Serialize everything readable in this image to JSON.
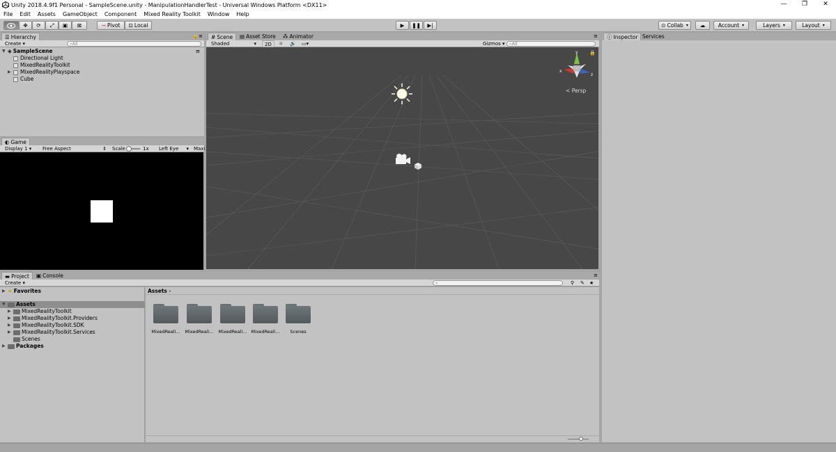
{
  "window": {
    "title": "Unity 2018.4.9f1 Personal - SampleScene.unity - ManipulationHandlerTest - Universal Windows Platform <DX11>",
    "buttons": [
      "—",
      "❐",
      "✕"
    ]
  },
  "menubar": [
    "File",
    "Edit",
    "Assets",
    "GameObject",
    "Component",
    "Mixed Reality Toolkit",
    "Window",
    "Help"
  ],
  "toolbar": {
    "pivot": "Pivot",
    "local": "Local",
    "collab": "Collab",
    "account": "Account",
    "layers": "Layers",
    "layout": "Layout"
  },
  "hierarchy": {
    "tab": "Hierarchy",
    "create": "Create",
    "search_placeholder": "All",
    "scene": "SampleScene",
    "items": [
      "Directional Light",
      "MixedRealityToolkit",
      "MixedRealityPlayspace",
      "Cube"
    ]
  },
  "game": {
    "tab": "Game",
    "display": "Display 1",
    "aspect": "Free Aspect",
    "scale_label": "Scale",
    "scale_value": "1x",
    "eye": "Left Eye",
    "maximize": "Maxi"
  },
  "scene": {
    "tabs": [
      "Scene",
      "Asset Store",
      "Animator"
    ],
    "shading": "Shaded",
    "mode_2d": "2D",
    "gizmos": "Gizmos",
    "search_placeholder": "All",
    "persp": "Persp",
    "axis_y": "y",
    "axis_x": "x",
    "axis_z": "z"
  },
  "inspector": {
    "tabs": [
      "Inspector",
      "Services"
    ]
  },
  "project": {
    "tabs": [
      "Project",
      "Console"
    ],
    "create": "Create",
    "favorites": "Favorites",
    "assets": "Assets",
    "asset_tree": [
      "MixedRealityToolkit",
      "MixedRealityToolkit.Providers",
      "MixedRealityToolkit.SDK",
      "MixedRealityToolkit.Services",
      "Scenes"
    ],
    "packages": "Packages",
    "breadcrumb": "Assets",
    "grid_items": [
      "MixedReali...",
      "MixedReali...",
      "MixedReali...",
      "MixedReali...",
      "Scenes"
    ]
  },
  "colors": {
    "scene_bg": "#474747",
    "panel_bg": "#c2c2c2",
    "axis_x": "#c83a2c",
    "axis_y": "#7dc43a",
    "axis_z": "#3a66c8"
  }
}
